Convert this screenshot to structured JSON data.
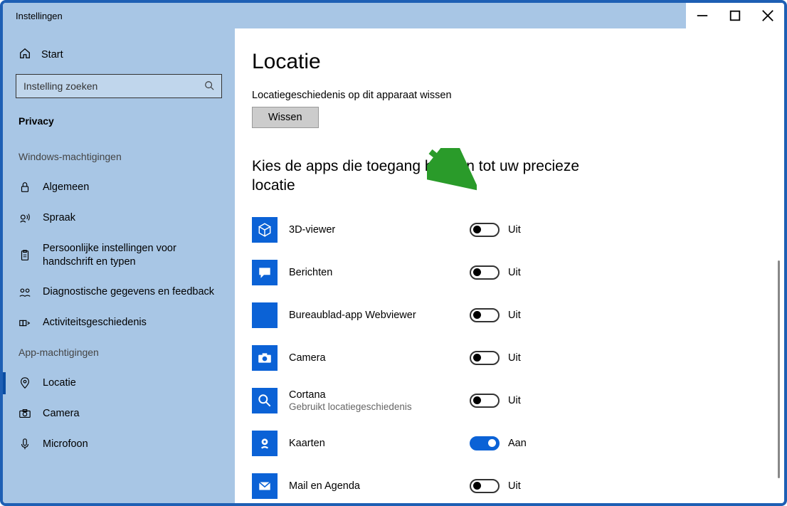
{
  "window": {
    "title": "Instellingen"
  },
  "sidebar": {
    "home_label": "Start",
    "search_placeholder": "Instelling zoeken",
    "current_section": "Privacy",
    "group1_label": "Windows-machtigingen",
    "group1_items": [
      {
        "label": "Algemeen",
        "icon": "lock"
      },
      {
        "label": "Spraak",
        "icon": "speech"
      },
      {
        "label": "Persoonlijke instellingen voor handschrift en typen",
        "icon": "clipboard"
      },
      {
        "label": "Diagnostische gegevens en feedback",
        "icon": "feedback"
      },
      {
        "label": "Activiteitsgeschiedenis",
        "icon": "activity"
      }
    ],
    "group2_label": "App-machtigingen",
    "group2_items": [
      {
        "label": "Locatie",
        "icon": "location",
        "active": true
      },
      {
        "label": "Camera",
        "icon": "camera"
      },
      {
        "label": "Microfoon",
        "icon": "microphone"
      }
    ]
  },
  "main": {
    "page_title": "Locatie",
    "history_label": "Locatiegeschiedenis op dit apparaat wissen",
    "clear_button": "Wissen",
    "section_heading": "Kies de apps die toegang hebben tot uw precieze locatie",
    "state_on": "Aan",
    "state_off": "Uit",
    "apps": [
      {
        "name": "3D-viewer",
        "icon": "cube",
        "on": false
      },
      {
        "name": "Berichten",
        "icon": "message",
        "on": false
      },
      {
        "name": "Bureaublad-app Webviewer",
        "icon": "blank",
        "on": false
      },
      {
        "name": "Camera",
        "icon": "camera-app",
        "on": false
      },
      {
        "name": "Cortana",
        "sub": "Gebruikt locatiegeschiedenis",
        "icon": "search-app",
        "on": false
      },
      {
        "name": "Kaarten",
        "icon": "maps",
        "on": true
      },
      {
        "name": "Mail en Agenda",
        "icon": "mail",
        "on": false
      }
    ]
  }
}
